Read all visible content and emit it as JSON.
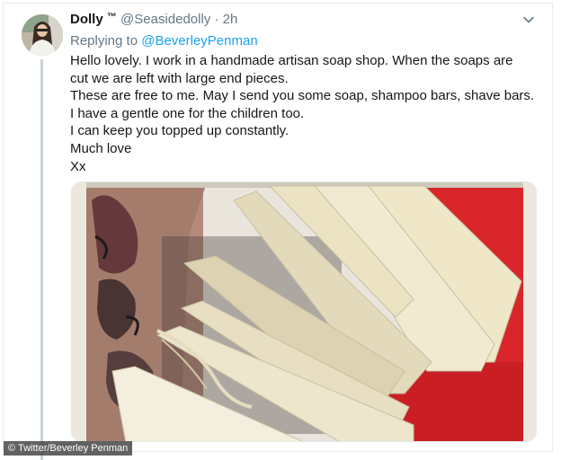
{
  "tweet": {
    "display_name": "Dolly",
    "tm": "™",
    "handle": "@Seasidedolly",
    "dot": "·",
    "time": "2h",
    "replying_prefix": "Replying to",
    "replying_handle": "@BeverleyPenman",
    "lines": [
      "Hello lovely. I work in a handmade artisan soap shop. When the soaps are",
      "cut we are left with large end pieces.",
      "These are free to me. May I send you some soap, shampoo bars, shave bars.",
      "I have a gentle one for the children too.",
      "I can keep you topped up constantly.",
      "Much love",
      "Xx"
    ],
    "menu_icon": "chevron-down-icon",
    "link_color": "#1da1f2"
  },
  "credit": "© Twitter/Beverley Penman"
}
